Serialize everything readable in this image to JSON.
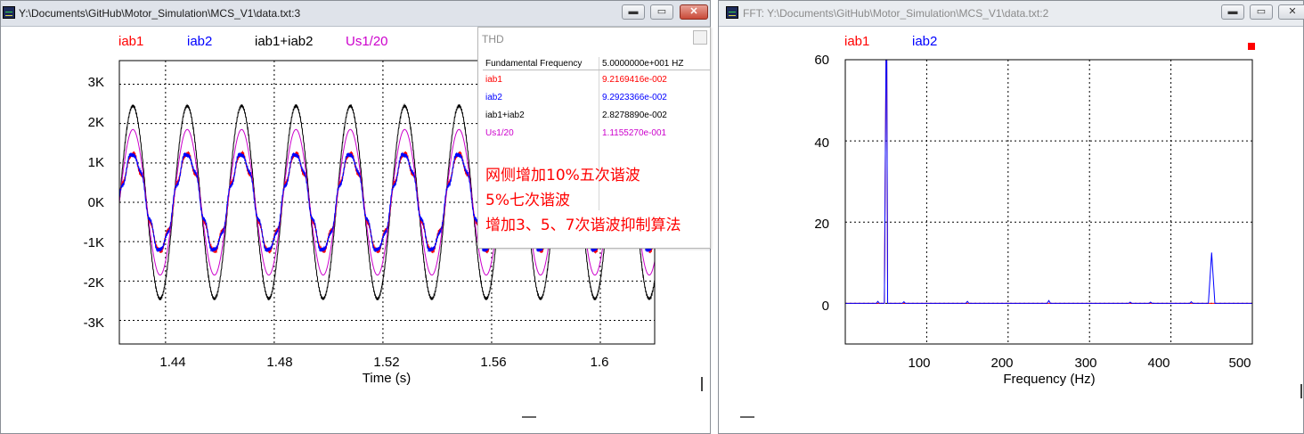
{
  "colors": {
    "iab1": "#ff0000",
    "iab2": "#0000ff",
    "sum": "#000000",
    "us": "#cc00cc",
    "grid": "#000000"
  },
  "left_window": {
    "title": "Y:\\Documents\\GitHub\\Motor_Simulation\\MCS_V1\\data.txt:3",
    "buttons": {
      "minimize": "▬",
      "maximize": "▭",
      "close": "✕"
    },
    "legend": [
      "iab1",
      "iab2",
      "iab1+iab2",
      "Us1/20"
    ],
    "xlabel": "Time (s)",
    "yticks": [
      "3K",
      "2K",
      "1K",
      "0K",
      "-1K",
      "-2K",
      "-3K"
    ],
    "xticks": [
      "1.44",
      "1.48",
      "1.52",
      "1.56",
      "1.6"
    ]
  },
  "thd_popup": {
    "title": "THD",
    "header": {
      "label": "Fundamental Frequency",
      "value": "5.0000000e+001 HZ"
    },
    "rows": [
      {
        "label": "iab1",
        "value": "9.2169416e-002"
      },
      {
        "label": "iab2",
        "value": "9.2923366e-002"
      },
      {
        "label": "iab1+iab2",
        "value": "2.8278890e-002"
      },
      {
        "label": "Us1/20",
        "value": "1.1155270e-001"
      }
    ],
    "notes": [
      "网侧增加10%五次谐波",
      "5%七次谐波",
      "增加3、5、7次谐波抑制算法"
    ]
  },
  "right_window": {
    "title": "FFT:  Y:\\Documents\\GitHub\\Motor_Simulation\\MCS_V1\\data.txt:2",
    "buttons": {
      "minimize": "▬",
      "maximize": "▭",
      "close": "✕"
    },
    "legend": [
      "iab1",
      "iab2"
    ],
    "xlabel": "Frequency (Hz)",
    "yticks": [
      "60",
      "40",
      "20",
      "0"
    ],
    "xticks": [
      "100",
      "200",
      "300",
      "400",
      "500"
    ]
  },
  "chart_data": [
    {
      "type": "line",
      "x_unit": "s",
      "xlim": [
        1.423,
        1.62
      ],
      "ylim": [
        -3.6,
        3.6
      ],
      "y_unit": "K",
      "xlabel": "Time (s)",
      "fundamental_hz": 50,
      "series": [
        {
          "name": "iab1",
          "amplitude": 1.2,
          "phase_deg": 0
        },
        {
          "name": "iab2",
          "amplitude": 1.2,
          "phase_deg": 0
        },
        {
          "name": "iab1+iab2",
          "amplitude": 2.45,
          "phase_deg": 0
        },
        {
          "name": "Us1/20",
          "amplitude": 1.85,
          "phase_deg": 0
        }
      ]
    },
    {
      "type": "line",
      "xlabel": "Frequency (Hz)",
      "xlim": [
        0,
        500
      ],
      "ylim": [
        -10,
        60
      ],
      "series": [
        {
          "name": "iab1",
          "points": [
            [
              0,
              0
            ],
            [
              48,
              0
            ],
            [
              50,
              60
            ],
            [
              51,
              60
            ],
            [
              52,
              0
            ],
            [
              500,
              0
            ]
          ]
        },
        {
          "name": "iab2",
          "points": [
            [
              0,
              0
            ],
            [
              38,
              0
            ],
            [
              40,
              0.5
            ],
            [
              42,
              0
            ],
            [
              48,
              0
            ],
            [
              50,
              60
            ],
            [
              51,
              60
            ],
            [
              52,
              0
            ],
            [
              70,
              0
            ],
            [
              72,
              0.4
            ],
            [
              74,
              0
            ],
            [
              148,
              0
            ],
            [
              150,
              0.5
            ],
            [
              152,
              0
            ],
            [
              248,
              0
            ],
            [
              250,
              0.7
            ],
            [
              252,
              0
            ],
            [
              348,
              0
            ],
            [
              350,
              0.3
            ],
            [
              352,
              0
            ],
            [
              373,
              0
            ],
            [
              375,
              0.3
            ],
            [
              377,
              0
            ],
            [
              423,
              0
            ],
            [
              425,
              0.4
            ],
            [
              427,
              0
            ],
            [
              446,
              0
            ],
            [
              450,
              12.5
            ],
            [
              454,
              0
            ],
            [
              500,
              0
            ]
          ]
        }
      ]
    }
  ]
}
